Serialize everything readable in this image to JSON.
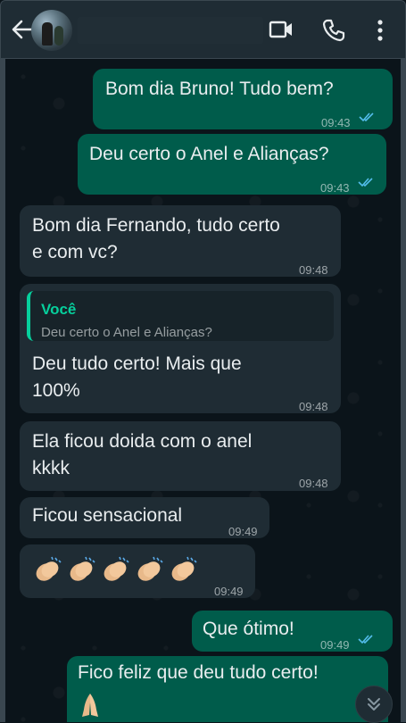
{
  "header": {
    "back_icon": "arrow-left-icon",
    "video_icon": "video-camera-icon",
    "call_icon": "phone-icon",
    "menu_icon": "more-vertical-icon"
  },
  "colors": {
    "outgoing_bubble": "#005c4b",
    "incoming_bubble": "#1f2c34",
    "quote_accent": "#06cf9c",
    "read_ticks": "#53bdeb",
    "background": "#0b141a"
  },
  "messages": [
    {
      "direction": "out",
      "text": "Bom dia Bruno! Tudo bem?",
      "time": "09:43",
      "status": "read"
    },
    {
      "direction": "out",
      "text": "Deu certo o Anel e Alianças?",
      "time": "09:43",
      "status": "read"
    },
    {
      "direction": "in",
      "line1": "Bom dia Fernando, tudo certo",
      "line2": "e com vc?",
      "time": "09:48"
    },
    {
      "direction": "in",
      "quote_name": "Você",
      "quote_text": "Deu certo o Anel e Alianças?",
      "line1": "Deu tudo certo! Mais que",
      "line2": "100%",
      "time": "09:48"
    },
    {
      "direction": "in",
      "line1": "Ela ficou doida com o anel",
      "line2": "kkkk",
      "time": "09:48"
    },
    {
      "direction": "in",
      "text": "Ficou sensacional",
      "time": "09:49"
    },
    {
      "direction": "in",
      "emoji": "clapping-hands x5",
      "time": "09:49"
    },
    {
      "direction": "out",
      "text": "Que ótimo!",
      "time": "09:49",
      "status": "read"
    },
    {
      "direction": "out",
      "text": "Fico feliz que deu tudo certo!",
      "emoji": "folded-hands",
      "status": "read"
    }
  ],
  "scroll_button_icon": "double-chevron-down-icon"
}
